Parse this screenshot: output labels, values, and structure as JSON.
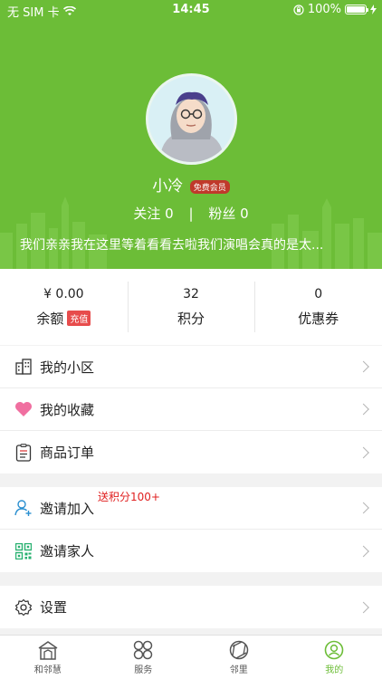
{
  "status_bar": {
    "carrier": "无 SIM 卡",
    "time": "14:45",
    "battery": "100%"
  },
  "profile": {
    "username": "小冷",
    "member_badge": "免费会员",
    "following_label": "关注 0",
    "separator": "|",
    "fans_label": "粉丝 0",
    "signature": "我们亲亲我在这里等着看看去啦我们演唱会真的是太..."
  },
  "stats": [
    {
      "value": "¥ 0.00",
      "label": "余额",
      "tag": "充值"
    },
    {
      "value": "32",
      "label": "积分"
    },
    {
      "value": "0",
      "label": "优惠券"
    }
  ],
  "menu": {
    "my_community": "我的小区",
    "my_favorites": "我的收藏",
    "orders": "商品订单",
    "invite_join": "邀请加入",
    "invite_promo": "送积分100+",
    "invite_family": "邀请家人",
    "settings": "设置"
  },
  "tabs": [
    {
      "label": "和邻慧",
      "icon": "home-building-icon"
    },
    {
      "label": "服务",
      "icon": "clover-grid-icon"
    },
    {
      "label": "邻里",
      "icon": "aperture-icon"
    },
    {
      "label": "我的",
      "icon": "user-circle-icon",
      "active": true
    }
  ],
  "colors": {
    "brand_green": "#6cbd37",
    "badge_red": "#c0392b",
    "promo_red": "#e02020"
  }
}
